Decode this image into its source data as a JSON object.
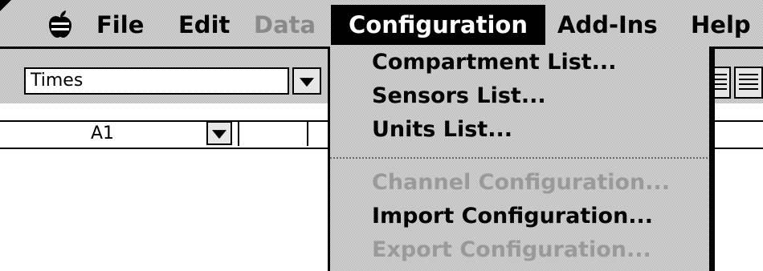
{
  "menubar": {
    "items": [
      {
        "label": "File",
        "enabled": true
      },
      {
        "label": "Edit",
        "enabled": true
      },
      {
        "label": "Data",
        "enabled": false
      },
      {
        "label": "Configuration",
        "enabled": true,
        "active": true
      },
      {
        "label": "Add-Ins",
        "enabled": true
      },
      {
        "label": "Help",
        "enabled": true
      }
    ]
  },
  "toolbar": {
    "font_value": "Times"
  },
  "formula_bar": {
    "cell_reference": "A1"
  },
  "configuration_menu": {
    "items": [
      {
        "label": "Compartment List...",
        "enabled": true
      },
      {
        "label": "Sensors List...",
        "enabled": true
      },
      {
        "label": "Units List...",
        "enabled": true
      },
      {
        "label": "Channel Configuration...",
        "enabled": false
      },
      {
        "label": "Import Configuration...",
        "enabled": true
      },
      {
        "label": "Export Configuration...",
        "enabled": false
      }
    ]
  },
  "colors": {
    "menubar_background": "#c8c8c8",
    "active_menu_background": "#000000",
    "disabled_text": "#9a9a9a"
  }
}
